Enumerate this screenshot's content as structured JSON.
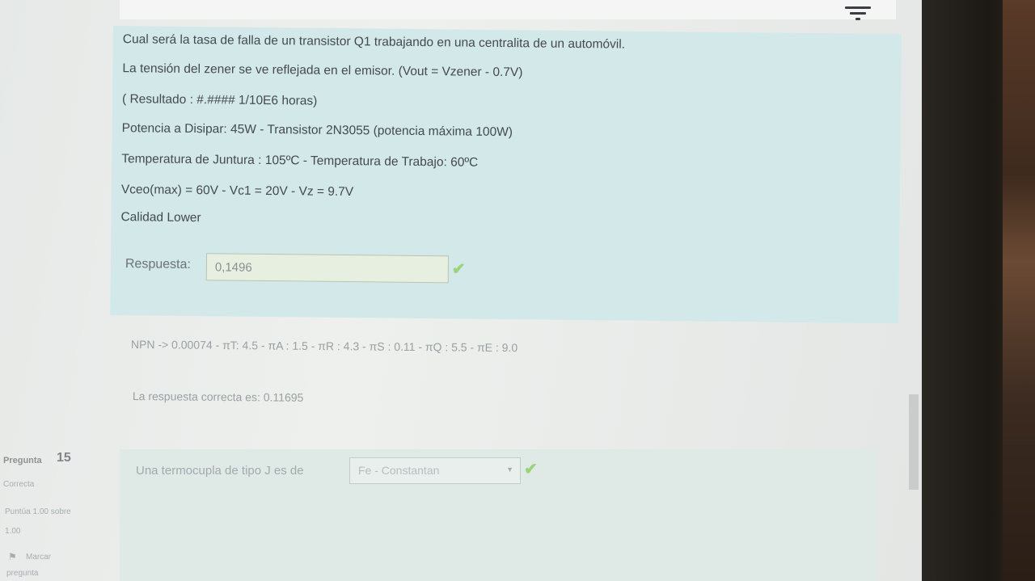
{
  "header": {
    "filter_icon": "filter-lines-icon"
  },
  "question": {
    "lines": [
      "Cual será la tasa de falla de un transistor Q1 trabajando en una centralita de un automóvil.",
      "La tensión del zener se ve reflejada en el emisor. (Vout = Vzener - 0.7V)",
      "( Resultado : #.####  1/10E6 horas)",
      "Potencia a Disipar: 45W - Transistor 2N3055 (potencia máxima 100W)",
      "Temperatura de Juntura : 105ºC  - Temperatura de Trabajo: 60ºC",
      "Vceo(max) = 60V - Vc1 = 20V - Vz = 9.7V",
      "Calidad Lower"
    ],
    "answer_label": "Respuesta:",
    "answer_value": "0,1496",
    "correct_mark": "✔"
  },
  "feedback": {
    "general": "NPN -> 0.00074  -  πT: 4.5  - πA : 1.5 - πR : 4.3 - πS : 0.11 - πQ : 5.5  - πE : 9.0",
    "right_answer": "La respuesta correcta es: 0.11695"
  },
  "next_question": {
    "label": "Pregunta",
    "number": "15",
    "state": "Correcta",
    "score_line_1": "Puntúa 1.00 sobre",
    "score_line_2": "1.00",
    "flag_icon": "flag-icon",
    "flag_label_1": "Marcar",
    "flag_label_2": "pregunta",
    "text": "Una termocupla de tipo J es de",
    "selected_option": "Fe - Constantan",
    "correct_mark": "✔"
  },
  "colors": {
    "question_bg": "#d3e8e9",
    "correct_green": "#9cd27a"
  }
}
